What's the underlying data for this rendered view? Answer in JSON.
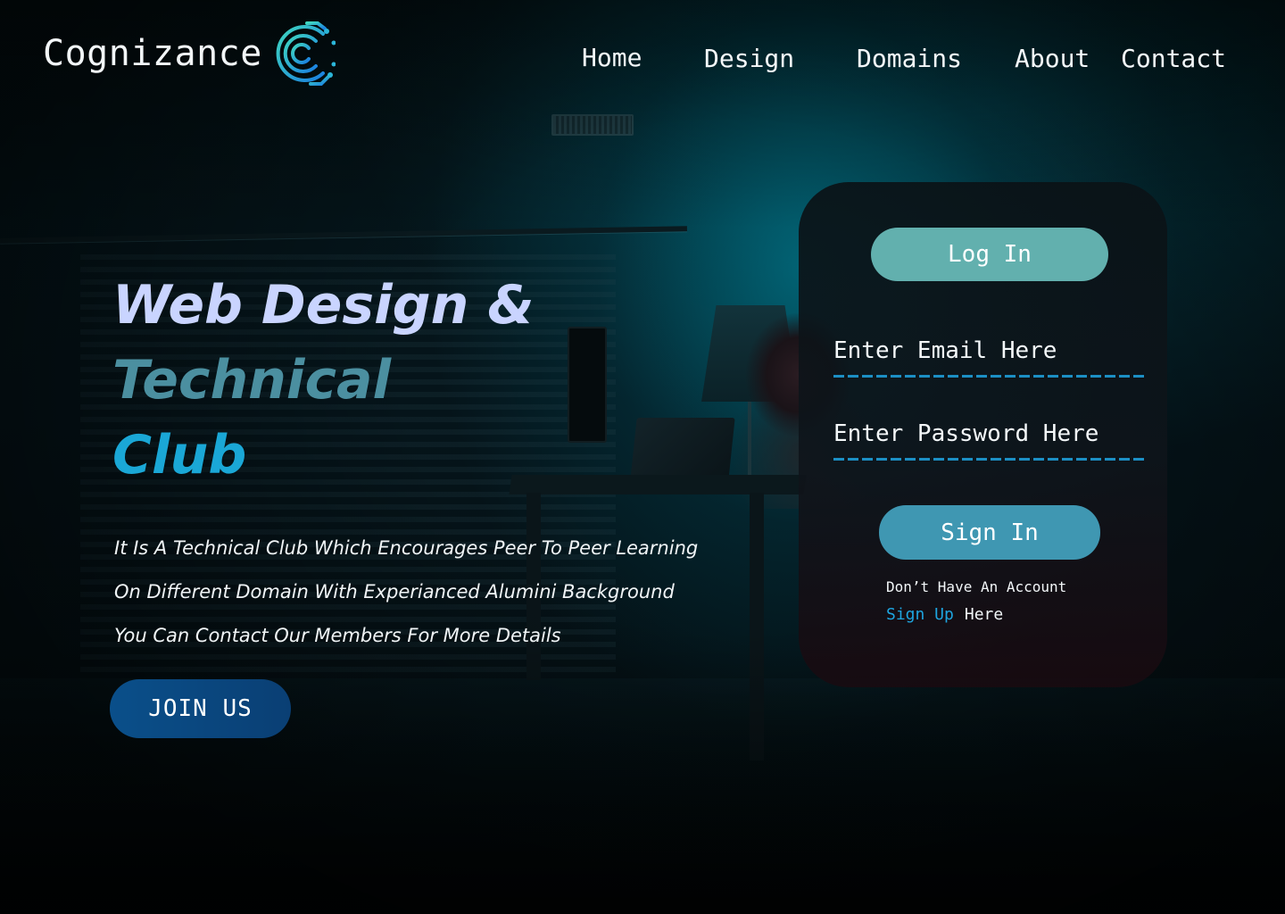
{
  "brand": {
    "name": "Cognizance",
    "accent": "#1aa7d6"
  },
  "nav": {
    "items": [
      {
        "label": "Home"
      },
      {
        "label": "Design"
      },
      {
        "label": "Domains"
      },
      {
        "label": "About"
      },
      {
        "label": "Contact"
      }
    ]
  },
  "hero": {
    "title_line1": "Web Design &",
    "title_line2": "Technical",
    "title_line3": "Club",
    "description": [
      "It Is A Technical Club Which Encourages Peer To Peer Learning",
      "On Different Domain With Experianced Alumini Background",
      "You Can Contact Our Members For More Details"
    ],
    "join_label": "JOIN US"
  },
  "login": {
    "title_button": "Log In",
    "email_placeholder": "Enter Email Here",
    "password_placeholder": "Enter Password Here",
    "signin_label": "Sign In",
    "no_account_text": "Don’t Have An Account",
    "signup_link": "Sign Up",
    "signup_suffix": "Here"
  },
  "colors": {
    "login_button": "#62b0ae",
    "signin_button": "#3f97b2",
    "join_button": "#0a4f8a",
    "title_line1": "#c9d4ff",
    "title_line2": "#4b8fa0",
    "title_line3": "#1aa7d6",
    "input_underline": "#1c8fc4"
  },
  "background_image": "dark room with hooded person at desk and lamp"
}
